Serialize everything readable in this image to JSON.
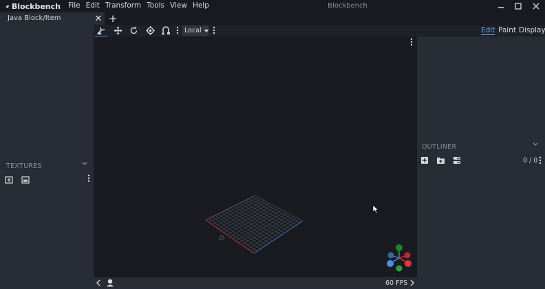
{
  "app": {
    "name": "Blockbench",
    "window_title": "Blockbench"
  },
  "menu": [
    "File",
    "Edit",
    "Transform",
    "Tools",
    "View",
    "Help"
  ],
  "tabs": [
    {
      "label": "Java Block/Item",
      "close": "✕"
    }
  ],
  "tab_add": "+",
  "toolbar": {
    "tools": [
      "move-tool-icon",
      "resize-tool-icon",
      "rotate-tool-icon",
      "pivot-tool-icon",
      "vertex-snap-icon"
    ],
    "space_select": "Local"
  },
  "modes": [
    "Edit",
    "Paint",
    "Display"
  ],
  "panels": {
    "textures": {
      "title": "TEXTURES"
    },
    "outliner": {
      "title": "OUTLINER",
      "count": "0 / 0"
    }
  },
  "status": {
    "fps": "60 FPS"
  },
  "colors": {
    "accent": "#3e90ff",
    "panel": "#282c34",
    "viewport": "#1a1b20",
    "titlebar": "#181a1f"
  }
}
